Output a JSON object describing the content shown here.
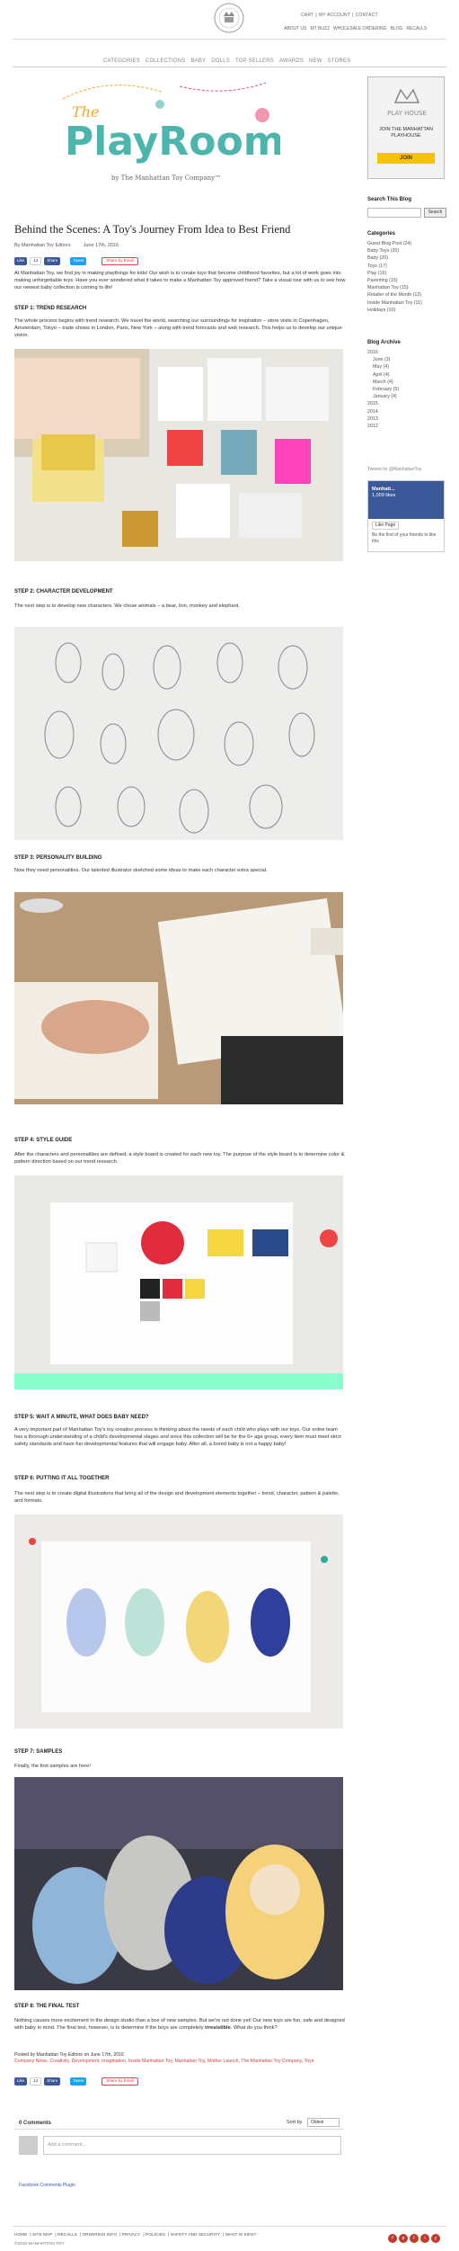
{
  "header": {
    "logo_text": "THE MANHATTAN TOY COMPANY",
    "top_links_1": [
      "CART",
      "MY ACCOUNT",
      "CONTACT"
    ],
    "top_links_2": [
      "ABOUT US",
      "MT BUZZ",
      "WHOLESALE ORDERING",
      "BLOG",
      "RECALLS"
    ],
    "nav": [
      "CATEGORIES",
      "COLLECTIONS",
      "BABY",
      "DOLLS",
      "TOP SELLERS",
      "AWARDS",
      "NEW",
      "STORES"
    ]
  },
  "blog": {
    "title_the": "The",
    "title": "PlayRoom",
    "subtitle": "by The Manhattan Toy Company™"
  },
  "post": {
    "title": "Behind the Scenes: A Toy's Journey From Idea to Best Friend",
    "author": "By Manhattan Toy Editors",
    "date": "June 17th, 2016",
    "share": {
      "fb": "Like",
      "fb_count": "14",
      "share": "Share",
      "tweet": "Tweet",
      "email": "Share by Email"
    },
    "intro": "At Manhattan Toy, we find joy in making playthings for kids! Our wish is to create toys that become childhood favorites, but a lot of work goes into making unforgettable toys. Have you ever wondered what it takes to make a Manhattan Toy approved friend? Take a visual tour with us to see how our newest baby collection is coming to life!",
    "step1": "STEP 1: TREND RESEARCH",
    "step1_text": "The whole process begins with trend research. We travel the world, searching our surroundings for inspiration – store visits in Copenhagen, Amsterdam, Tokyo – trade shows in London, Paris, New York – along with trend forecasts and web research. This helps us to develop our unique vision.",
    "step2": "STEP 2: CHARACTER DEVELOPMENT",
    "step2_text": "The next step is to develop new characters. We chose animals – a bear, lion, monkey and elephant.",
    "step3": "STEP 3: PERSONALITY BUILDING",
    "step3_text": "Now they need personalities. Our talented illustrator sketched some ideas to make each character extra special.",
    "step4": "STEP 4: STYLE GUIDE",
    "step4_text": "After the characters and personalities are defined, a style board is created for each new toy. The purpose of the style board is to determine color & pattern direction based on our trend research.",
    "step5": "STEP 5: WAIT A MINUTE, WHAT DOES BABY NEED?",
    "step5_text": "A very important part of Manhattan Toy's toy creation process is thinking about the needs of each child who plays with our toys. Our entire team has a thorough understanding of a child's developmental stages and since this collection will be for the 0+ age group, every item must meet strict safety standards and have fun developmental features that will engage baby. After all, a bored baby is not a happy baby!",
    "step6": "STEP 6: PUTTING IT ALL TOGETHER",
    "step6_text": "The next step is to create digital illustrations that bring all of the design and development elements together – trend, character, pattern & palette, and formats.",
    "step7": "STEP 7: SAMPLES",
    "step7_text": "Finally, the first samples are here!",
    "step8": "STEP 8: THE FINAL TEST",
    "step8_text_a": "Nothing causes more excitement in the design studio than a box of new samples. But we're not done yet! Our new toys are fun, safe and designed with baby in mind. The final test, however, is to determine if the boys are completely ",
    "step8_bold": "irresistible",
    "step8_text_b": ". What do you think?",
    "posted_by": "Posted by Manhattan Toy Editors on June 17th, 2016",
    "tags": "Company News, Creativity, Development, Imagination, Inside Manhattan Toy, Manhattan Toy, Mother Launch, The Manhattan Toy Company, Toys"
  },
  "comments": {
    "count": "0 Comments",
    "sort_label": "Sort by",
    "sort_value": "Oldest",
    "placeholder": "Add a comment...",
    "plugin": "Facebook Comments Plugin"
  },
  "sidebar": {
    "ad_title": "PLAY HOUSE",
    "ad_join": "JOIN THE MANHATTAN PLAYHOUSE",
    "ad_button": "JOIN",
    "search_head": "Search This Blog",
    "search_btn": "Search",
    "categories_head": "Categories",
    "categories": [
      "Guest Blog Post (24)",
      "Baby Toys (20)",
      "Baby (20)",
      "Toys (17)",
      "Play (16)",
      "Parenting (15)",
      "Manhattan Toy (15)",
      "Retailer of the Month (12)",
      "Inside Manhattan Toy (11)",
      "Holidays (10)"
    ],
    "archive_head": "Blog Archive",
    "archive": [
      "2016",
      "June (3)",
      "May (4)",
      "April (4)",
      "March (4)",
      "February (5)",
      "January (4)",
      "2015",
      "2014",
      "2013",
      "2012"
    ],
    "tweets": "Tweets by @ManhattanToy",
    "fb_name": "Manhatt...",
    "fb_likes": "1,009 likes",
    "fb_like": "Like Page",
    "fb_text": "Be the first of your friends to like this"
  },
  "footer": {
    "links": [
      "HOME",
      "SITE MAP",
      "RECALLS",
      "ORDERING INFO",
      "PRIVACY",
      "POLICIES",
      "SAFETY AND SECURITY",
      "WHAT IS KIDS?"
    ],
    "copyright": "©2016 MANHATTAN TOY",
    "social": [
      "f",
      "p",
      "t",
      "i",
      "y"
    ]
  }
}
